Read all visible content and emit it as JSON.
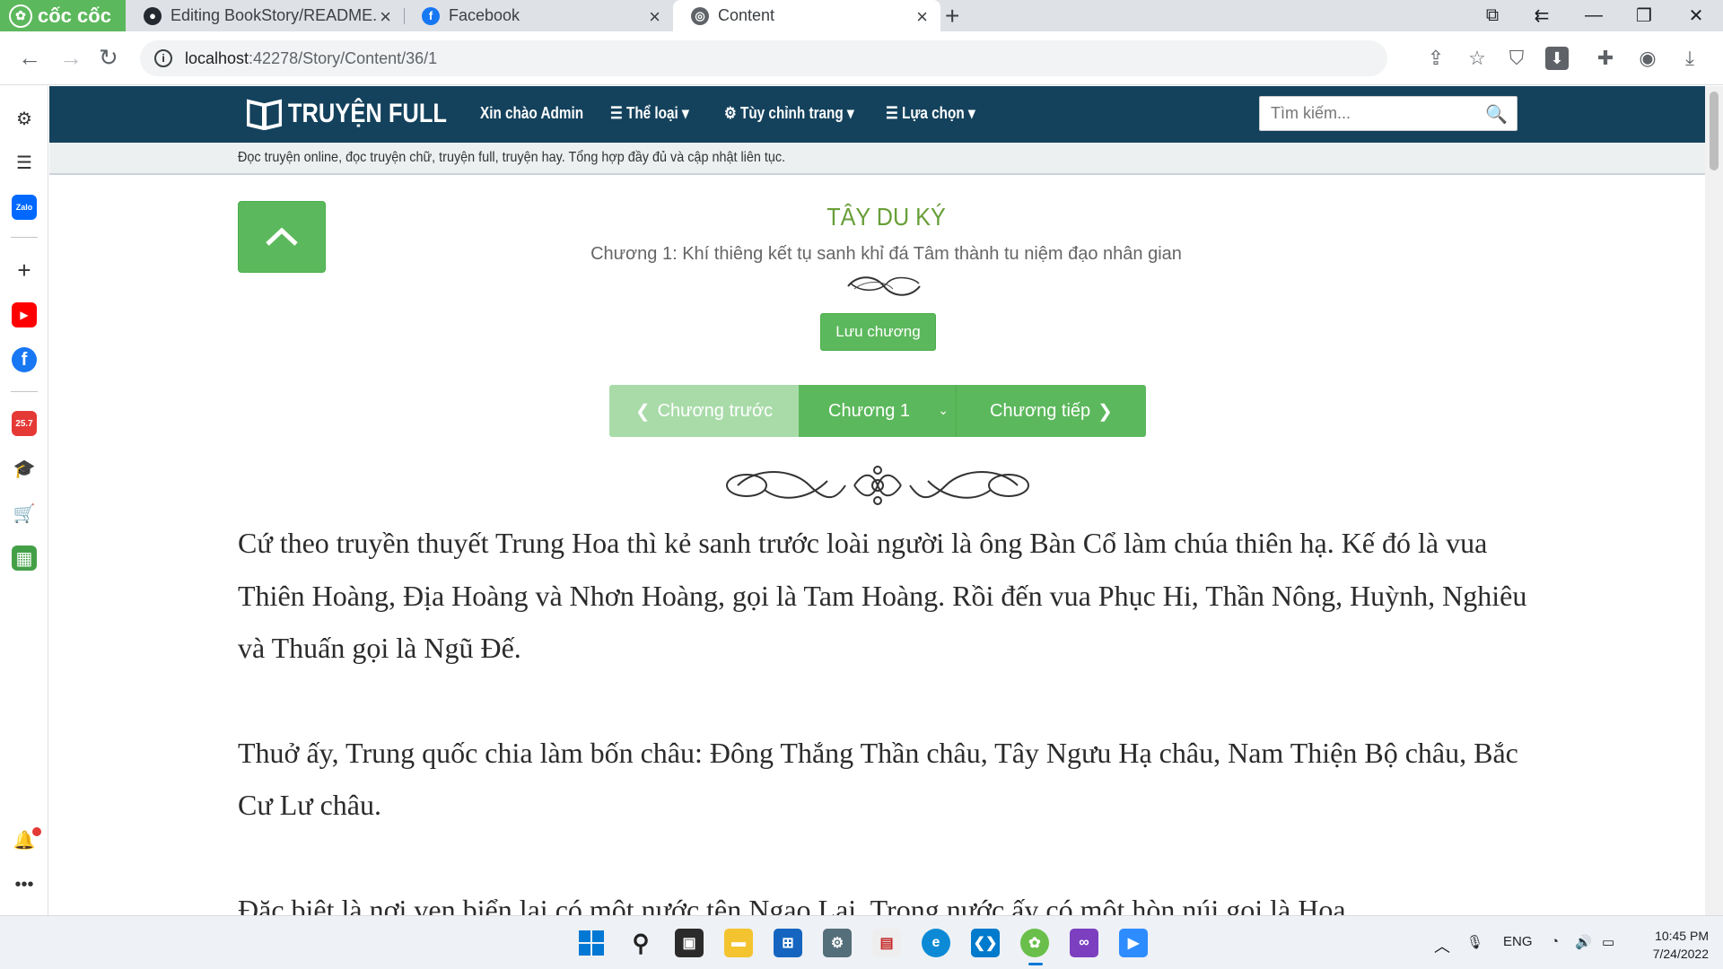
{
  "browser": {
    "brand": "cốc cốc",
    "tabs": [
      {
        "title": "Editing BookStory/README.m",
        "active": false
      },
      {
        "title": "Facebook",
        "active": false
      },
      {
        "title": "Content",
        "active": true
      }
    ],
    "url_host": "localhost",
    "url_path": ":42278/Story/Content/36/1"
  },
  "site": {
    "logo_text": "TRUYỆN FULL",
    "greeting": "Xin chào Admin",
    "menu": [
      "Thể loại",
      "Tùy chỉnh trang",
      "Lựa chọn"
    ],
    "search_placeholder": "Tìm kiếm...",
    "tagline": "Đọc truyện online, đọc truyện chữ, truyện full, truyện hay. Tổng hợp đầy đủ và cập nhật liên tục."
  },
  "story": {
    "title": "TÂY DU KÝ",
    "chapter_title": "Chương 1: Khí thiêng kết tụ sanh khỉ đá Tâm thành tu niệm đạo nhân gian",
    "save_label": "Lưu chương",
    "prev_label": "Chương trước",
    "current_chapter": "Chương 1",
    "next_label": "Chương tiếp",
    "paragraphs": [
      "Cứ theo truyền thuyết Trung Hoa thì kẻ sanh trước loài người là ông Bàn Cổ làm chúa thiên hạ. Kế đó là vua Thiên Hoàng, Địa Hoàng và Nhơn Hoàng, gọi là Tam Hoàng. Rồi đến vua Phục Hi, Thần Nông, Huỳnh, Nghiêu và Thuấn gọi là Ngũ Đế.",
      "Thuở ấy, Trung quốc chia làm bốn châu: Đông Thắng Thần châu, Tây Ngưu Hạ châu, Nam Thiện Bộ châu, Bắc Cư Lư châu.",
      "Đặc biệt là nơi ven biển lại có một nước tên Ngạo Lai. Trong nước ấy có một hòn núi gọi là Hoa"
    ]
  },
  "taskbar": {
    "lang": "ENG",
    "time": "10:45 PM",
    "date": "7/24/2022"
  },
  "colors": {
    "site_nav": "#14425d",
    "accent_green": "#5cb85c",
    "title_green": "#689f38",
    "brand_green": "#5cb85c"
  }
}
